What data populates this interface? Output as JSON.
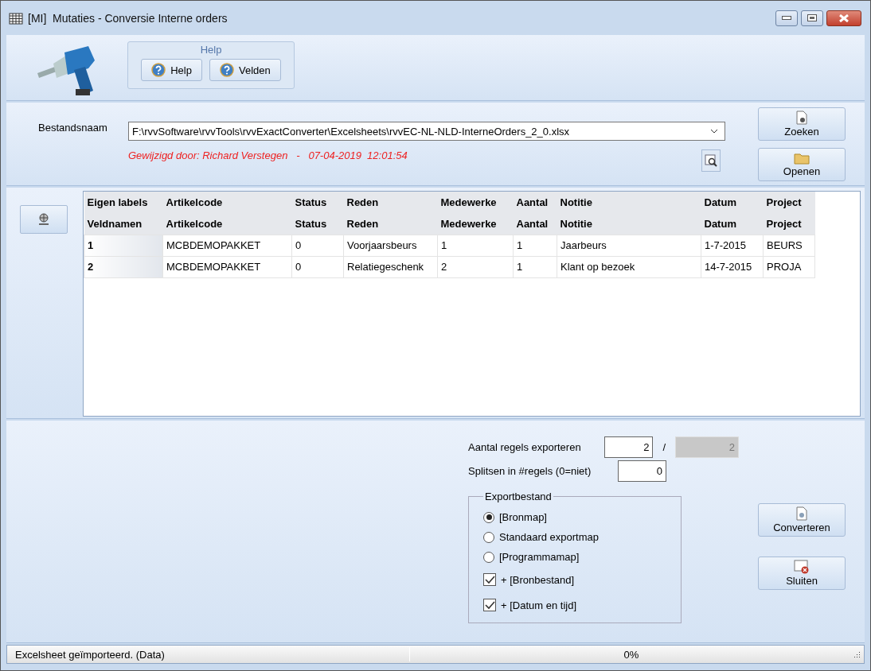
{
  "window": {
    "title": "[MI]  Mutaties - Conversie Interne orders"
  },
  "help_group": {
    "title": "Help",
    "buttons": [
      {
        "label": "Help"
      },
      {
        "label": "Velden"
      }
    ]
  },
  "file": {
    "label": "Bestandsnaam",
    "value": "F:\\rvvSoftware\\rvvTools\\rvvExactConverter\\Excelsheets\\rvvEC-NL-NLD-InterneOrders_2_0.xlsx",
    "modified": "Gewijzigd door: Richard Verstegen   -   07-04-2019  12:01:54"
  },
  "file_buttons": [
    {
      "label": "Zoeken",
      "kind": "search"
    },
    {
      "label": "Openen",
      "kind": "open"
    }
  ],
  "grid": {
    "header_rows": [
      {
        "cells": [
          "Eigen labels",
          "Artikelcode",
          "Status",
          "Reden",
          "Medewerke",
          "Aantal",
          "Notitie",
          "Datum",
          "Project"
        ]
      },
      {
        "cells": [
          "Veldnamen",
          "Artikelcode",
          "Status",
          "Reden",
          "Medewerke",
          "Aantal",
          "Notitie",
          "Datum",
          "Project"
        ]
      }
    ],
    "rows": [
      {
        "cells": [
          "1",
          "MCBDEMOPAKKET",
          "0",
          "Voorjaarsbeurs",
          "1",
          "1",
          "Jaarbeurs",
          "1-7-2015",
          "BEURS"
        ]
      },
      {
        "cells": [
          "2",
          "MCBDEMOPAKKET",
          "0",
          "Relatiegeschenk",
          "2",
          "1",
          "Klant op bezoek",
          "14-7-2015",
          "PROJA"
        ]
      }
    ]
  },
  "export": {
    "count_label": "Aantal regels exporteren",
    "count_value": "2",
    "separator": "/",
    "total_value": "2",
    "split_label": "Splitsen in #regels (0=niet)",
    "split_value": "0",
    "group_title": "Exportbestand",
    "options": [
      {
        "label": "[Bronmap]",
        "selected": true
      },
      {
        "label": "Standaard exportmap",
        "selected": false
      },
      {
        "label": "[Programmamap]",
        "selected": false
      }
    ],
    "checks": [
      {
        "label": "+ [Bronbestand]",
        "checked": true
      },
      {
        "label": "+ [Datum en tijd]",
        "checked": true
      }
    ]
  },
  "action_buttons": [
    {
      "label": "Converteren",
      "kind": "convert"
    },
    {
      "label": "Sluiten",
      "kind": "close"
    }
  ],
  "status_bar": {
    "message": "Excelsheet geïmporteerd. (Data)",
    "progress": {
      "level": 0,
      "reading": "0%"
    }
  }
}
